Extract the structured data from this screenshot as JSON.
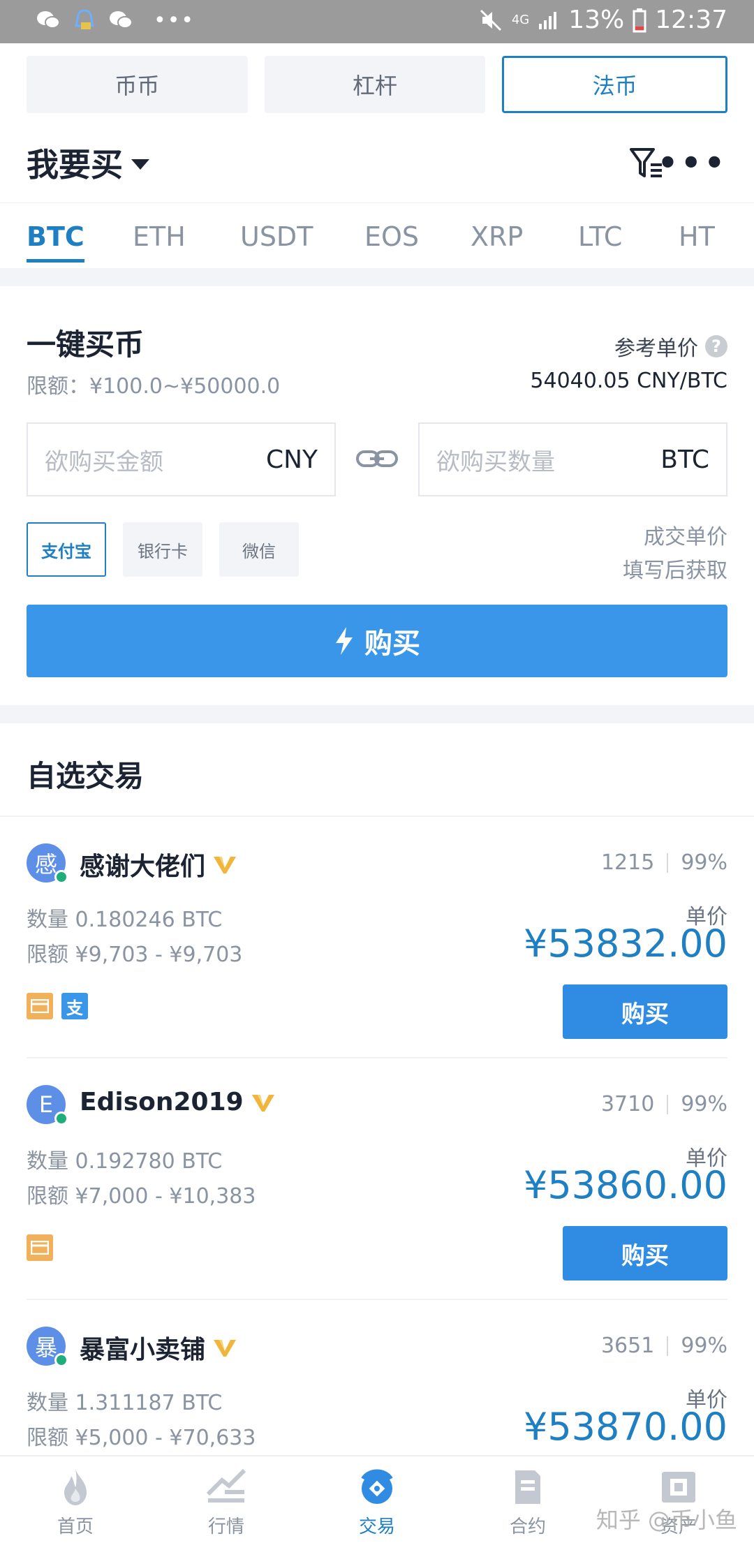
{
  "status_bar": {
    "battery": "13%",
    "time": "12:37",
    "network": "4G"
  },
  "mode_tabs": [
    {
      "label": "币币",
      "active": false
    },
    {
      "label": "杠杆",
      "active": false
    },
    {
      "label": "法币",
      "active": true
    }
  ],
  "header": {
    "title": "我要买"
  },
  "coin_tabs": [
    "BTC",
    "ETH",
    "USDT",
    "EOS",
    "XRP",
    "LTC",
    "HT"
  ],
  "quick_buy": {
    "title": "一键买币",
    "limit": "限额：¥100.0~¥50000.0",
    "ref_label": "参考单价",
    "ref_price": "54040.05 CNY/BTC",
    "amount_placeholder": "欲购买金额",
    "amount_unit": "CNY",
    "qty_placeholder": "欲购买数量",
    "qty_unit": "BTC",
    "pay_methods": [
      "支付宝",
      "银行卡",
      "微信"
    ],
    "note_line1": "成交单价",
    "note_line2": "填写后获取",
    "buy_label": "购买"
  },
  "favorites": {
    "title": "自选交易",
    "unit_label": "单价",
    "buy_label": "购买",
    "ads": [
      {
        "avatar": "感",
        "name": "感谢大佬们",
        "orders": "1215",
        "rate": "99%",
        "qty": "数量 0.180246 BTC",
        "limit": "限额 ¥9,703 - ¥9,703",
        "price": "¥53832.00",
        "pay": [
          "card",
          "alipay"
        ],
        "alipay_glyph": "支"
      },
      {
        "avatar": "E",
        "name": "Edison2019",
        "orders": "3710",
        "rate": "99%",
        "qty": "数量 0.192780 BTC",
        "limit": "限额 ¥7,000 - ¥10,383",
        "price": "¥53860.00",
        "pay": [
          "card"
        ]
      },
      {
        "avatar": "暴",
        "name": "暴富小卖铺",
        "orders": "3651",
        "rate": "99%",
        "qty": "数量 1.311187 BTC",
        "limit": "限额 ¥5,000 - ¥70,633",
        "price": "¥53870.00",
        "pay": []
      }
    ]
  },
  "bottom_nav": [
    {
      "label": "首页",
      "icon": "flame-icon",
      "active": false
    },
    {
      "label": "行情",
      "icon": "market-chart-icon",
      "active": false
    },
    {
      "label": "交易",
      "icon": "exchange-icon",
      "active": true
    },
    {
      "label": "合约",
      "icon": "contract-document-icon",
      "active": false
    },
    {
      "label": "资产",
      "icon": "wallet-icon",
      "active": false
    }
  ],
  "watermark": "知乎 @币小鱼",
  "colors": {
    "accent": "#1e7fc2",
    "buy_button": "#3a96e8",
    "online": "#1fae7a",
    "vip": "#f0b53a"
  }
}
